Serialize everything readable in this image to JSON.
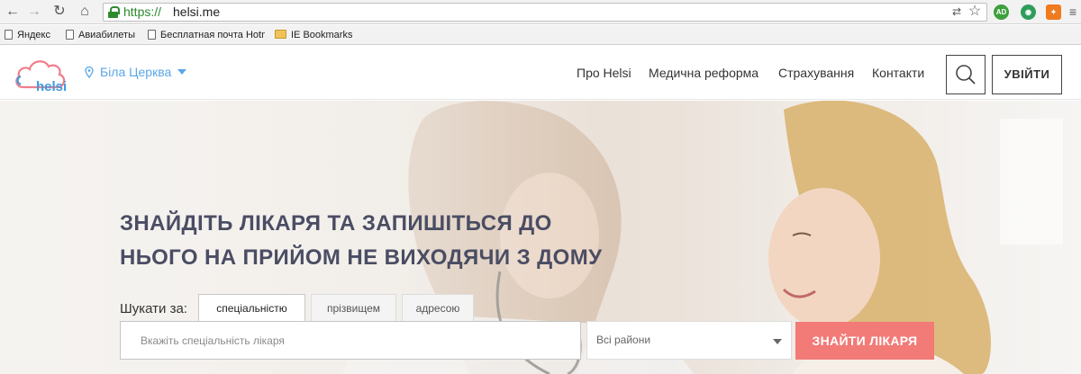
{
  "browser": {
    "url_scheme": "https://",
    "url_host": "helsi.me",
    "extensions": [
      "AD"
    ],
    "bookmarks": [
      {
        "label": "Яндекс",
        "icon": "page-icon"
      },
      {
        "label": "Авиабилеты",
        "icon": "page-icon"
      },
      {
        "label": "Бесплатная почта Hotm",
        "icon": "page-icon"
      },
      {
        "label": "IE Bookmarks",
        "icon": "folder-icon"
      }
    ]
  },
  "header": {
    "logo_text": "helsi",
    "city": "Біла Церква",
    "menu": [
      {
        "label": "Про Helsi"
      },
      {
        "label": "Медична реформа"
      },
      {
        "label": "Страхування"
      },
      {
        "label": "Контакти"
      }
    ],
    "login_label": "УВІЙТИ"
  },
  "hero": {
    "headline_line1": "ЗНАЙДІТЬ ЛІКАРЯ ТА ЗАПИШІТЬСЯ ДО",
    "headline_line2": "НЬОГО НА ПРИЙОМ НЕ ВИХОДЯЧИ З ДОМУ",
    "search_by_label": "Шукати за:",
    "tabs": [
      {
        "label": "спеціальністю",
        "active": true
      },
      {
        "label": "прізвищем",
        "active": false
      },
      {
        "label": "адресою",
        "active": false
      }
    ],
    "specialty_placeholder": "Вкажіть спеціальність лікаря",
    "district_selected": "Всі райони",
    "find_button": "ЗНАЙТИ ЛІКАРЯ"
  },
  "colors": {
    "brand_blue": "#3d9be0",
    "accent_coral": "#f27a77",
    "headline": "#4a4d63"
  }
}
